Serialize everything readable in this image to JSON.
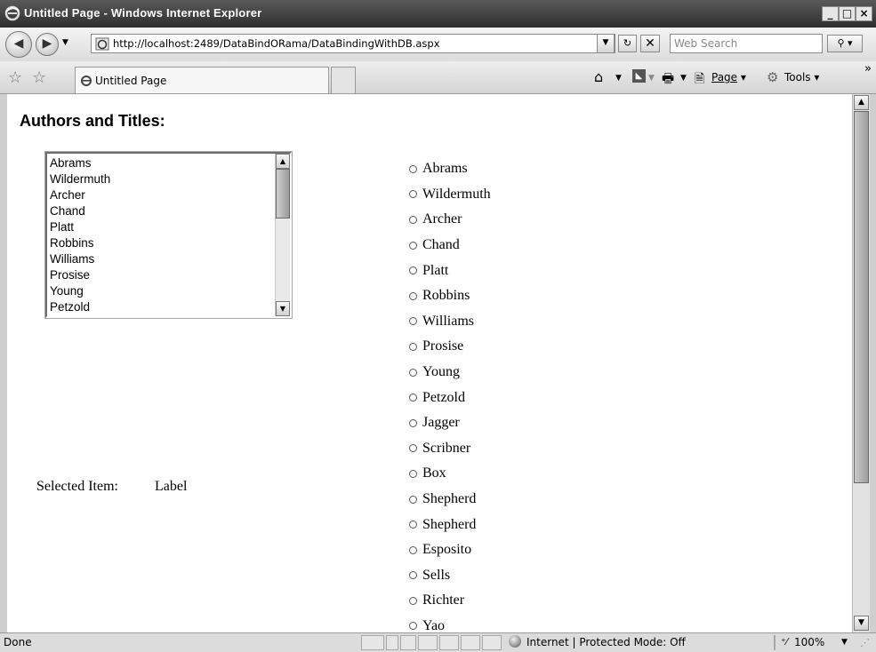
{
  "window": {
    "title": "Untitled Page - Windows Internet Explorer",
    "minimize": "_",
    "maximize": "□",
    "close": "×"
  },
  "address": {
    "url": "http://localhost:2489/DataBindORama/DataBindingWithDB.aspx",
    "search_placeholder": "Web Search"
  },
  "tab": {
    "label": "Untitled Page"
  },
  "toolbar": {
    "page_label": "Page",
    "tools_label": "Tools",
    "more": "»"
  },
  "page": {
    "heading": "Authors and Titles:",
    "listbox_items": [
      "Abrams",
      "Wildermuth",
      "Archer",
      "Chand",
      "Platt",
      "Robbins",
      "Williams",
      "Prosise",
      "Young",
      "Petzold"
    ],
    "radio_items": [
      "Abrams",
      "Wildermuth",
      "Archer",
      "Chand",
      "Platt",
      "Robbins",
      "Williams",
      "Prosise",
      "Young",
      "Petzold",
      "Jagger",
      "Scribner",
      "Box",
      "Shepherd",
      "Shepherd",
      "Esposito",
      "Sells",
      "Richter",
      "Yao"
    ],
    "selected_label": "Selected Item:",
    "selected_value": "Label"
  },
  "status": {
    "text": "Done",
    "zone": "Internet | Protected Mode: Off",
    "zoom": "100%"
  },
  "icons": [
    "ie-logo-icon",
    "back-icon",
    "forward-icon",
    "refresh-icon",
    "stop-icon",
    "search-icon",
    "favorites-star-icon",
    "add-favorites-icon",
    "home-icon",
    "feeds-icon",
    "print-icon",
    "page-icon",
    "tools-gear-icon",
    "globe-icon"
  ]
}
